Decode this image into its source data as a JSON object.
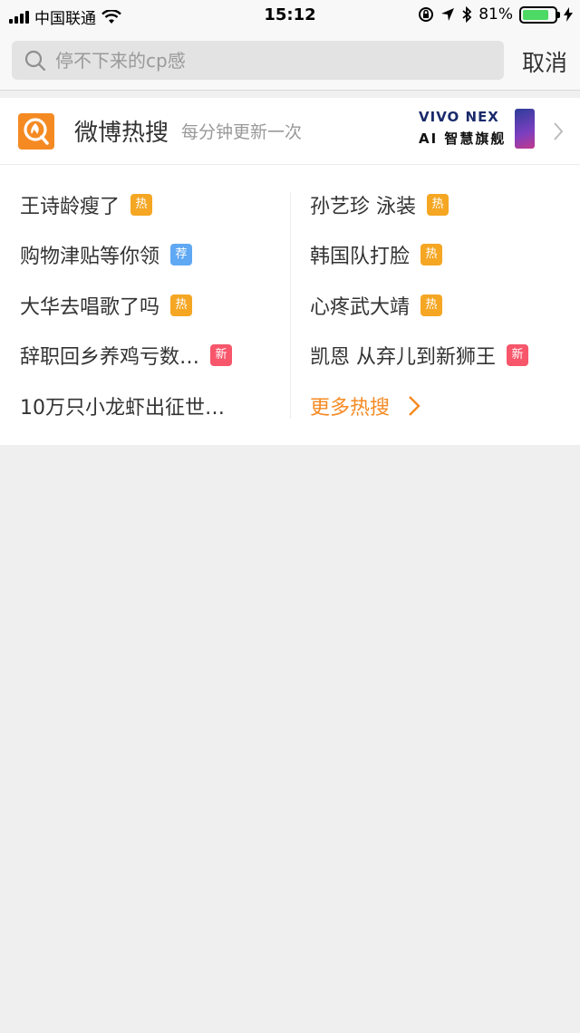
{
  "status_bar": {
    "carrier": "中国联通",
    "time": "15:12",
    "battery": "81%",
    "battery_level": 0.81
  },
  "search": {
    "placeholder": "停不下来的cp感",
    "cancel_label": "取消"
  },
  "hot": {
    "title": "微博热搜",
    "subtitle": "每分钟更新一次",
    "ad_brand": "VIVO NEX",
    "ad_slogan": "AI 智慧旗舰",
    "left_items": [
      {
        "label": "王诗龄瘦了",
        "badge": "热",
        "badge_color": "#f5a623"
      },
      {
        "label": "购物津贴等你领",
        "badge": "荐",
        "badge_color": "#5fa8f3"
      },
      {
        "label": "大华去唱歌了吗",
        "badge": "热",
        "badge_color": "#f5a623"
      },
      {
        "label": "辞职回乡养鸡亏数…",
        "badge": "新",
        "badge_color": "#f7566b"
      },
      {
        "label": "10万只小龙虾出征世…",
        "badge": "",
        "badge_color": ""
      }
    ],
    "right_items": [
      {
        "label": "孙艺珍 泳装",
        "badge": "热",
        "badge_color": "#f5a623"
      },
      {
        "label": "韩国队打脸",
        "badge": "热",
        "badge_color": "#f5a623"
      },
      {
        "label": "心疼武大靖",
        "badge": "热",
        "badge_color": "#f5a623"
      },
      {
        "label": "凯恩 从弃儿到新狮王",
        "badge": "新",
        "badge_color": "#f7566b"
      }
    ],
    "more_label": "更多热搜"
  }
}
